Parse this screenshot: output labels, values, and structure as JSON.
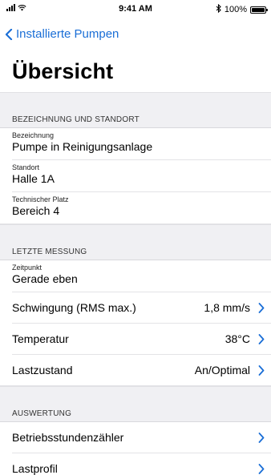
{
  "status_bar": {
    "time": "9:41 AM",
    "battery": "100%",
    "icons": [
      "signal-icon",
      "wifi-icon",
      "bluetooth-icon",
      "battery-icon"
    ]
  },
  "nav": {
    "back_label": "Installierte Pumpen"
  },
  "page": {
    "title": "Übersicht"
  },
  "sections": {
    "location": {
      "header": "BEZEICHNUNG UND STANDORT",
      "fields": [
        {
          "label": "Bezeichnung",
          "value": "Pumpe in Reinigungsanlage"
        },
        {
          "label": "Standort",
          "value": "Halle 1A"
        },
        {
          "label": "Technischer Platz",
          "value": "Bereich 4"
        }
      ]
    },
    "measurement": {
      "header": "LETZTE MESSUNG",
      "timestamp": {
        "label": "Zeitpunkt",
        "value": "Gerade eben"
      },
      "rows": [
        {
          "label": "Schwingung (RMS max.)",
          "value": "1,8 mm/s"
        },
        {
          "label": "Temperatur",
          "value": "38°C"
        },
        {
          "label": "Lastzustand",
          "value": "An/Optimal"
        }
      ]
    },
    "evaluation": {
      "header": "AUSWERTUNG",
      "rows": [
        {
          "label": "Betriebsstundenzähler"
        },
        {
          "label": "Lastprofil"
        }
      ]
    }
  },
  "colors": {
    "accent": "#1a6ed6",
    "grouped_background": "#f0f0f3",
    "separator": "#e3e3e6"
  }
}
